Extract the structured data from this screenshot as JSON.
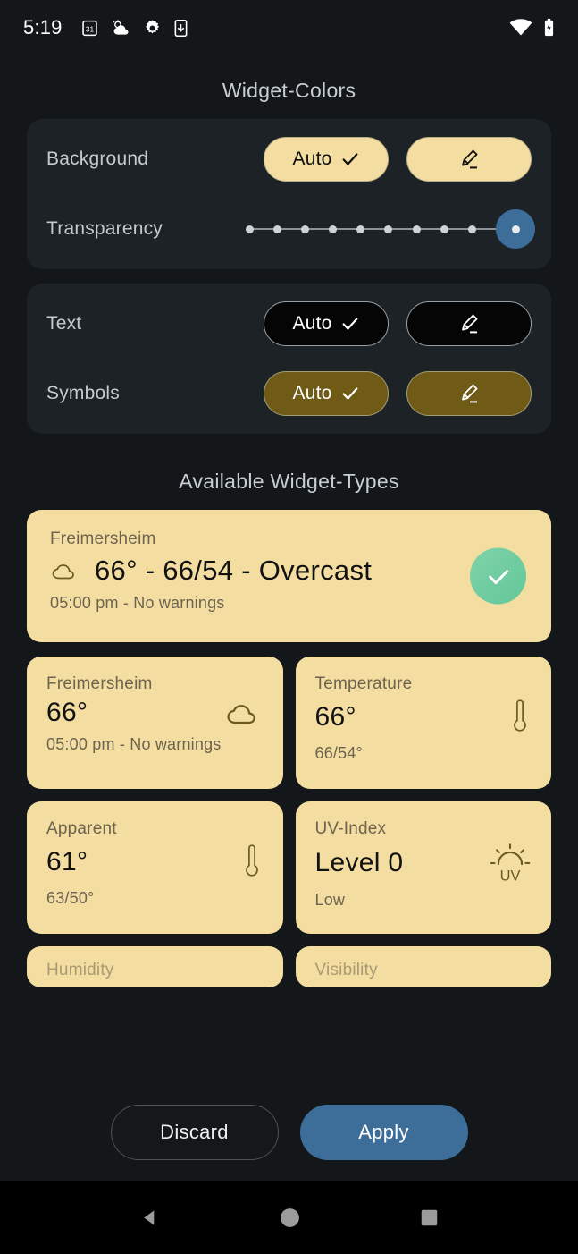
{
  "statusbar": {
    "time": "5:19",
    "left_icons": [
      "calendar-31-icon",
      "partly-cloudy-icon",
      "gear-icon",
      "download-to-phone-icon"
    ],
    "right_icons": [
      "wifi-icon",
      "battery-charging-icon"
    ]
  },
  "colors": {
    "page_bg": "#13171a",
    "group_bg": "#1d2226",
    "cream": "#f3dda1",
    "olive": "#6f5a16",
    "accent_blue": "#3d6e9a",
    "check_green": "#6ecfa0",
    "label_gray": "#c5cace"
  },
  "widget_colors": {
    "title": "Widget-Colors",
    "rows": [
      {
        "label": "Background",
        "auto_label": "Auto",
        "auto_style": "cream",
        "edit_icon": "pencil-edit-icon",
        "selected": true
      },
      {
        "label": "Transparency",
        "slider": {
          "ticks": 11,
          "value": 10,
          "max": 10
        }
      },
      {
        "label": "Text",
        "auto_label": "Auto",
        "auto_style": "black",
        "edit_icon": "pencil-edit-icon",
        "selected": true
      },
      {
        "label": "Symbols",
        "auto_label": "Auto",
        "auto_style": "olive",
        "edit_icon": "pencil-edit-icon",
        "selected": true
      }
    ]
  },
  "widget_types": {
    "title": "Available Widget-Types",
    "wide_card": {
      "location": "Freimersheim",
      "icon": "cloud-icon",
      "main": "66° - 66/54 - Overcast",
      "sub": "05:00 pm - No warnings",
      "selected_icon": "check-circle-icon",
      "selected": true
    },
    "cards": [
      {
        "title": "Freimersheim",
        "value": "66°",
        "sub": "05:00 pm - No warnings",
        "icon": "cloud-icon"
      },
      {
        "title": "Temperature",
        "value": "66°",
        "sub": "66/54°",
        "icon": "thermometer-icon"
      },
      {
        "title": "Apparent",
        "value": "61°",
        "sub": "63/50°",
        "icon": "thermometer-icon"
      },
      {
        "title": "UV-Index",
        "value": "Level 0",
        "sub": "Low",
        "icon": "uv-sun-icon"
      }
    ],
    "clipped_cards": [
      {
        "title": "Humidity"
      },
      {
        "title": "Visibility"
      }
    ]
  },
  "footer": {
    "discard_label": "Discard",
    "apply_label": "Apply"
  },
  "navbar": {
    "back": "back-triangle-icon",
    "home": "home-circle-icon",
    "recents": "recents-square-icon"
  }
}
